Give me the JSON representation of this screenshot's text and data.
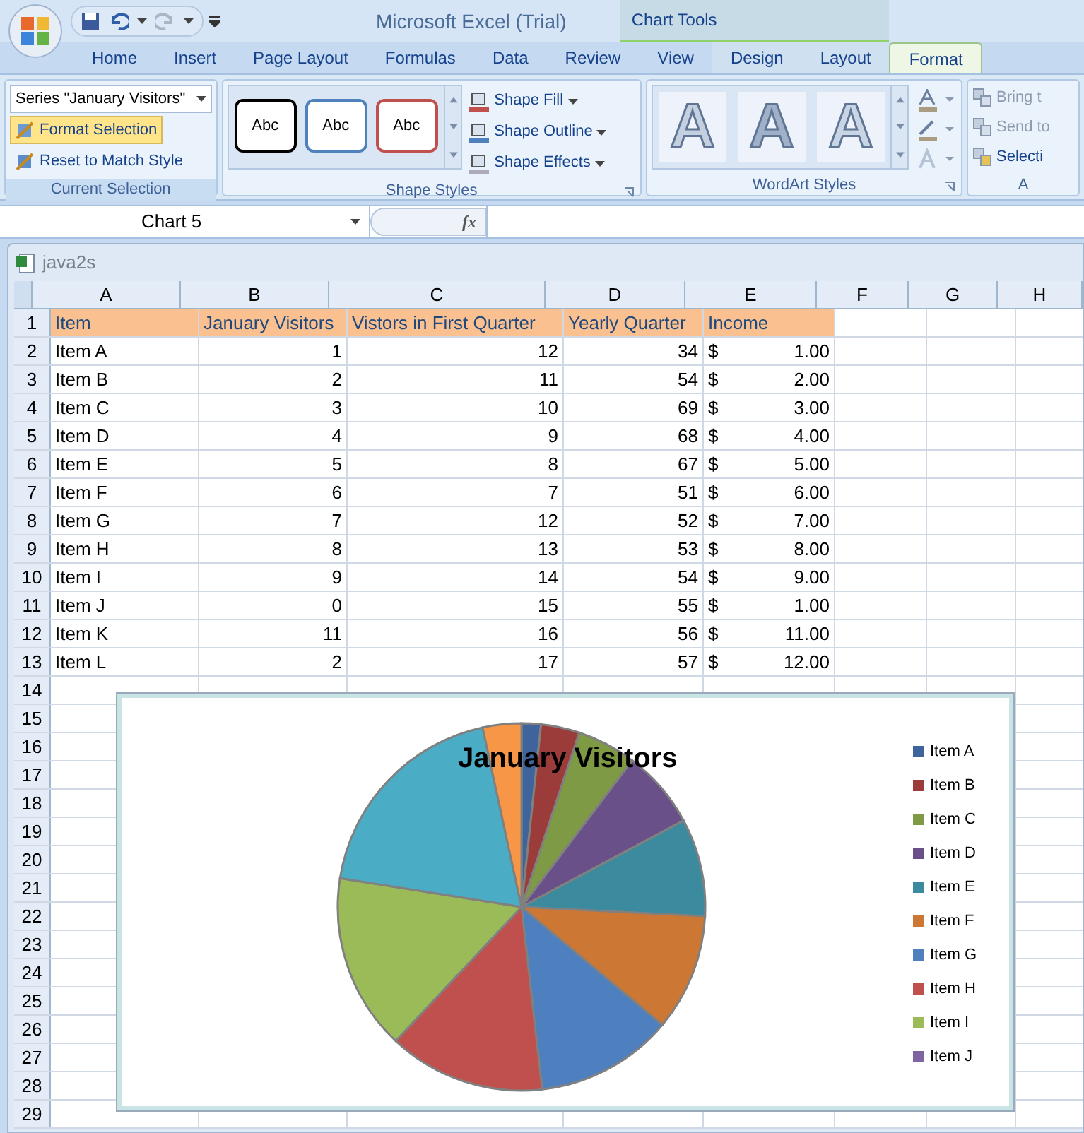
{
  "title_bar": {
    "title": "Microsoft Excel (Trial)",
    "context_label": "Chart Tools"
  },
  "tabs": [
    {
      "label": "Home",
      "selected": false,
      "kind": "main"
    },
    {
      "label": "Insert",
      "selected": false,
      "kind": "main"
    },
    {
      "label": "Page Layout",
      "selected": false,
      "kind": "main"
    },
    {
      "label": "Formulas",
      "selected": false,
      "kind": "main"
    },
    {
      "label": "Data",
      "selected": false,
      "kind": "main"
    },
    {
      "label": "Review",
      "selected": false,
      "kind": "main"
    },
    {
      "label": "View",
      "selected": false,
      "kind": "main"
    },
    {
      "label": "Design",
      "selected": false,
      "kind": "contextual"
    },
    {
      "label": "Layout",
      "selected": false,
      "kind": "contextual"
    },
    {
      "label": "Format",
      "selected": true,
      "kind": "contextual"
    }
  ],
  "current_selection": {
    "title": "Current Selection",
    "dropdown": "Series \"January Visitors\"",
    "buttons": [
      {
        "label": "Format Selection",
        "highlighted": true
      },
      {
        "label": "Reset to Match Style",
        "highlighted": false
      }
    ]
  },
  "shape_styles": {
    "title": "Shape Styles",
    "presets": [
      {
        "label": "Abc",
        "color": "#000000"
      },
      {
        "label": "Abc",
        "color": "#4f81bd"
      },
      {
        "label": "Abc",
        "color": "#c0504d"
      }
    ],
    "commands": [
      "Shape Fill",
      "Shape Outline",
      "Shape Effects"
    ]
  },
  "wordart_styles": {
    "title": "WordArt Styles",
    "presets": [
      "A",
      "A",
      "A"
    ]
  },
  "arrange": {
    "title": "A",
    "commands": [
      "Bring t",
      "Send to",
      "Selecti"
    ]
  },
  "formula_bar": {
    "name_box": "Chart 5",
    "fx": "fx"
  },
  "workbook": {
    "title": "java2s",
    "columns": [
      "A",
      "B",
      "C",
      "D",
      "E",
      "F",
      "G",
      "H"
    ],
    "header": [
      "Item",
      "January Visitors",
      "Vistors in First Quarter",
      "Yearly Quarter",
      "Income"
    ],
    "rows": [
      {
        "item": "Item A",
        "january": "1",
        "first_quarter": "12",
        "yearly": "34",
        "currency": "$",
        "income": "1.00"
      },
      {
        "item": "Item B",
        "january": "2",
        "first_quarter": "11",
        "yearly": "54",
        "currency": "$",
        "income": "2.00"
      },
      {
        "item": "Item C",
        "january": "3",
        "first_quarter": "10",
        "yearly": "69",
        "currency": "$",
        "income": "3.00"
      },
      {
        "item": "Item D",
        "january": "4",
        "first_quarter": "9",
        "yearly": "68",
        "currency": "$",
        "income": "4.00"
      },
      {
        "item": "Item E",
        "january": "5",
        "first_quarter": "8",
        "yearly": "67",
        "currency": "$",
        "income": "5.00"
      },
      {
        "item": "Item F",
        "january": "6",
        "first_quarter": "7",
        "yearly": "51",
        "currency": "$",
        "income": "6.00"
      },
      {
        "item": "Item G",
        "january": "7",
        "first_quarter": "12",
        "yearly": "52",
        "currency": "$",
        "income": "7.00"
      },
      {
        "item": "Item H",
        "january": "8",
        "first_quarter": "13",
        "yearly": "53",
        "currency": "$",
        "income": "8.00"
      },
      {
        "item": "Item I",
        "january": "9",
        "first_quarter": "14",
        "yearly": "54",
        "currency": "$",
        "income": "9.00"
      },
      {
        "item": "Item J",
        "january": "0",
        "first_quarter": "15",
        "yearly": "55",
        "currency": "$",
        "income": "1.00"
      },
      {
        "item": "Item K",
        "january": "11",
        "first_quarter": "16",
        "yearly": "56",
        "currency": "$",
        "income": "11.00"
      },
      {
        "item": "Item L",
        "january": "2",
        "first_quarter": "17",
        "yearly": "57",
        "currency": "$",
        "income": "12.00"
      }
    ],
    "row_numbers": [
      "1",
      "2",
      "3",
      "4",
      "5",
      "6",
      "7",
      "8",
      "9",
      "10",
      "11",
      "12",
      "13",
      "14",
      "15",
      "16",
      "17",
      "18",
      "19",
      "20",
      "21",
      "22",
      "23",
      "24",
      "25",
      "26",
      "27",
      "28",
      "29"
    ]
  },
  "chart": {
    "chart_data": {
      "type": "pie",
      "title": "January Visitors",
      "series": [
        {
          "values": [
            1.7,
            3.4,
            5.2,
            6.9,
            8.6,
            10.3,
            12.1,
            13.8,
            15.5,
            0,
            19.1,
            3.4
          ]
        }
      ]
    },
    "legend": [
      {
        "label": "Item A",
        "color": "#3f649b"
      },
      {
        "label": "Item B",
        "color": "#9b3c3a"
      },
      {
        "label": "Item C",
        "color": "#7e9a44"
      },
      {
        "label": "Item D",
        "color": "#6a5089"
      },
      {
        "label": "Item E",
        "color": "#3b8a9e"
      },
      {
        "label": "Item F",
        "color": "#cc7834"
      },
      {
        "label": "Item G",
        "color": "#4e7fbe"
      },
      {
        "label": "Item H",
        "color": "#c0504d"
      },
      {
        "label": "Item I",
        "color": "#9bbb59"
      },
      {
        "label": "Item J",
        "color": "#8064a2"
      }
    ]
  }
}
